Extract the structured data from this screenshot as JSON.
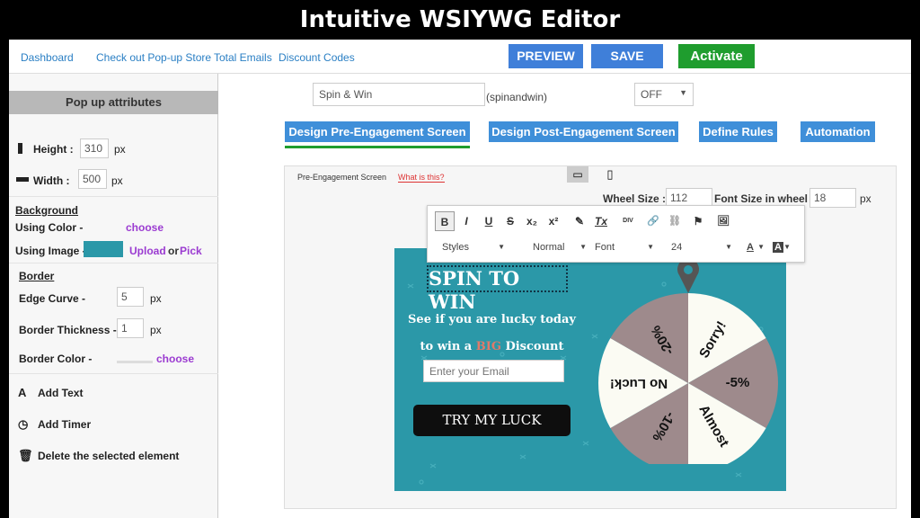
{
  "banner_title": "Intuitive WSIYWG Editor",
  "nav": {
    "links": [
      "Dashboard",
      "Check out Pop-up Store",
      "Total Emails",
      "Discount Codes"
    ],
    "preview": "PREVIEW",
    "save": "SAVE",
    "activate": "Activate"
  },
  "sidebar": {
    "heading": "Pop up attributes",
    "height_label": "Height :",
    "height_value": "310",
    "width_label": "Width :",
    "width_value": "500",
    "px": "px",
    "background_heading": "Background",
    "using_color": "Using Color -",
    "choose": "choose",
    "using_image": "Using Image -",
    "upload": "Upload",
    "or": "or",
    "pick": "Pick",
    "border_heading": "Border",
    "edge_curve": "Edge Curve -",
    "edge_value": "5",
    "border_thickness": "Border Thickness -",
    "thickness_value": "1",
    "border_color": "Border Color -",
    "add_text": "Add Text",
    "add_timer": "Add Timer",
    "delete": "Delete the selected element"
  },
  "editor": {
    "name_value": "Spin & Win",
    "slug": "(spinandwin)",
    "status": "OFF",
    "tabs": [
      "Design Pre-Engagement Screen",
      "Design Post-Engagement Screen",
      "Define Rules",
      "Automation"
    ],
    "screen_label": "Pre-Engagement Screen",
    "what_is_this": "What is this?",
    "wheel_size_label": "Wheel Size :",
    "wheel_size_value": "112",
    "font_size_label": "Font Size in wheel :",
    "font_size_value": "18",
    "px": "px"
  },
  "toolbar": {
    "buttons": [
      "B",
      "I",
      "U",
      "S",
      "x₂",
      "x²",
      "✎",
      "Tx",
      "DIV",
      "🔗",
      "⛓",
      "⚑",
      "🖼"
    ],
    "styles": "Styles",
    "normal": "Normal",
    "font": "Font",
    "size": "24",
    "text_color": "A",
    "bg_color": "A"
  },
  "popup": {
    "title": "SPIN TO WIN",
    "line1": "See if you are lucky today",
    "line2_pre": "to win a",
    "line2_big": "BIG",
    "line2_post": "Discount",
    "email_placeholder": "Enter your Email",
    "cta": "TRY MY LUCK",
    "wheel_labels": [
      "Sorry!",
      "-5%",
      "Almost",
      "-10%",
      "No Luck!",
      "-20%"
    ]
  },
  "colors": {
    "nav_blue": "#3f7fd9",
    "activate_green": "#1f9d2e",
    "popup_teal": "#2b98a8",
    "wheel_dark": "#9e8a8c",
    "wheel_light": "#fbfbf3"
  }
}
